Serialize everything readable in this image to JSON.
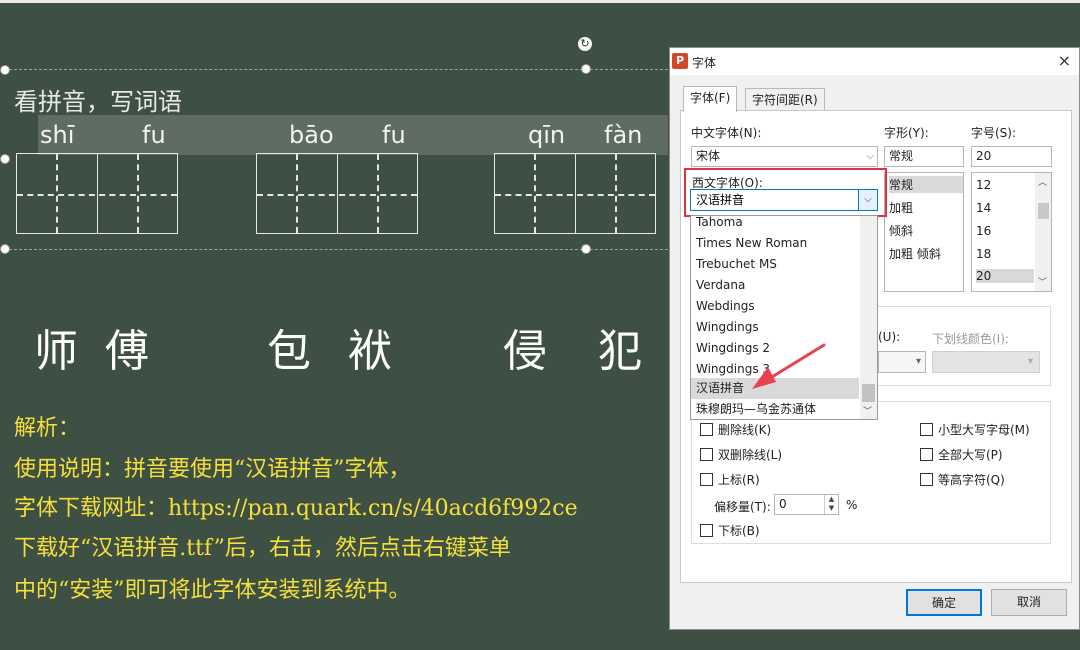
{
  "slide": {
    "title": "看拼音，写词语",
    "pinyin": [
      "shī",
      "fu",
      "bāo",
      "fu",
      "qīn",
      "fàn"
    ],
    "hanzi": [
      "师",
      "傅",
      "包",
      "袱",
      "侵",
      "犯"
    ],
    "notes": [
      "解析：",
      "使用说明：拼音要使用“汉语拼音”字体，",
      "字体下载网址：https://pan.quark.cn/s/40acd6f992ce",
      "下载好“汉语拼音.ttf”后，右击，然后点击右键菜单",
      "中的“安装”即可将此字体安装到系统中。"
    ]
  },
  "dialog": {
    "app_icon": "P",
    "title": "字体",
    "close_icon": "×",
    "tabs": [
      "字体(F)",
      "字符间距(R)"
    ],
    "cn_font_label": "中文字体(N):",
    "cn_font_value": "宋体",
    "style_label": "字形(Y):",
    "style_value": "常规",
    "size_label": "字号(S):",
    "size_value": "20",
    "west_font_label": "西文字体(O):",
    "west_font_value": "汉语拼音",
    "style_options": [
      "常规",
      "加粗",
      "倾斜",
      "加粗 倾斜"
    ],
    "size_options": [
      "12",
      "14",
      "16",
      "18",
      "20"
    ],
    "underline_label": "(U):",
    "underline_color_label": "下划线颜色(I):",
    "effects": {
      "strikethrough": "删除线(K)",
      "double_strike": "双删除线(L)",
      "superscript": "上标(R)",
      "offset_label": "偏移量(T):",
      "offset_value": "0",
      "offset_unit": "%",
      "subscript": "下标(B)",
      "small_caps": "小型大写字母(M)",
      "all_caps": "全部大写(P)",
      "equal_height": "等高字符(Q)"
    },
    "ok": "确定",
    "cancel": "取消"
  },
  "font_dropdown": {
    "options": [
      "Tahoma",
      "Times New Roman",
      "Trebuchet MS",
      "Verdana",
      "Webdings",
      "Wingdings",
      "Wingdings 2",
      "Wingdings 3",
      "汉语拼音",
      "珠穆朗玛—乌金苏通体"
    ],
    "selected": "汉语拼音"
  },
  "colors": {
    "chalkboard": "#3e4f44",
    "note_yellow": "#f4e03a",
    "highlight_red": "#e0323d",
    "accent_blue": "#0078d7"
  }
}
